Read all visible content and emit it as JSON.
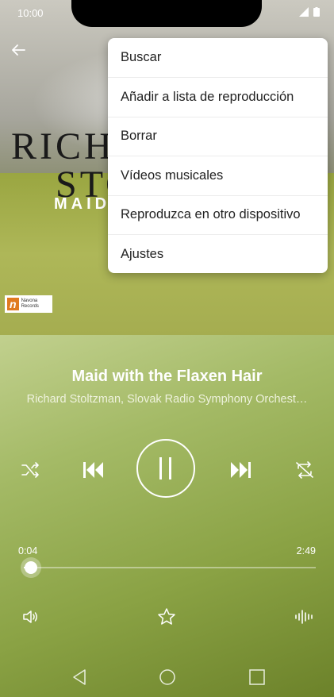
{
  "status_bar": {
    "time": "10:00"
  },
  "album": {
    "line1": "RICH",
    "line2": "STO",
    "line3": "MAID",
    "label_logo_letter": "n",
    "label_logo_text_1": "Navona",
    "label_logo_text_2": "Records"
  },
  "menu": {
    "items": [
      {
        "label": "Buscar"
      },
      {
        "label": "Añadir a lista de reproducción"
      },
      {
        "label": "Borrar"
      },
      {
        "label": "Vídeos musicales"
      },
      {
        "label": "Reproduzca en otro dispositivo"
      },
      {
        "label": "Ajustes"
      }
    ]
  },
  "track": {
    "title": "Maid with the Flaxen Hair",
    "artist": "Richard Stoltzman, Slovak Radio Symphony Orchest…",
    "elapsed": "0:04",
    "total": "2:49",
    "progress_fraction": 0.024
  },
  "icons": {
    "back": "back-arrow-icon",
    "shuffle": "shuffle-icon",
    "previous": "skip-previous-icon",
    "pause": "pause-icon",
    "next": "skip-next-icon",
    "repeat": "repeat-icon",
    "volume": "volume-icon",
    "favorite": "star-icon",
    "equalizer": "equalizer-icon"
  },
  "colors": {
    "accent_green": "#8aa244",
    "text_white": "#ffffff"
  }
}
